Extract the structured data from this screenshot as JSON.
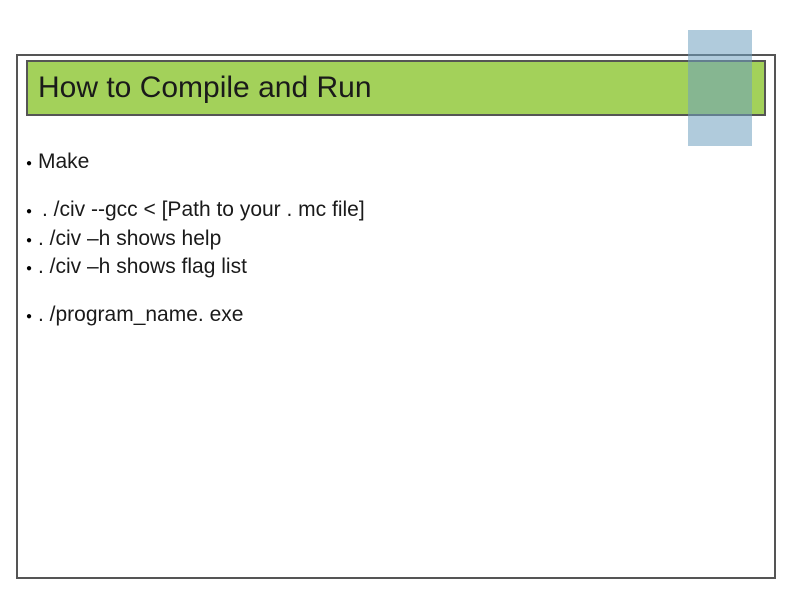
{
  "title": "How to Compile and Run",
  "groups": [
    {
      "items": [
        "Make"
      ]
    },
    {
      "items": [
        ". /civ --gcc < [Path to your . mc file]",
        ". /civ –h shows help",
        ". /civ –h shows flag list"
      ]
    },
    {
      "items": [
        ". /program_name. exe"
      ]
    }
  ]
}
